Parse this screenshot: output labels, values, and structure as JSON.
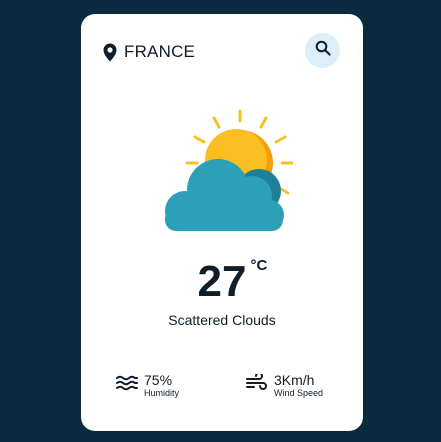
{
  "location": {
    "icon": "location-pin-icon",
    "name": "FRANCE"
  },
  "search": {
    "icon": "search-icon"
  },
  "weather": {
    "icon": "partly-cloudy-icon",
    "temperature": "27",
    "unit": "°C",
    "description": "Scattered Clouds"
  },
  "stats": {
    "humidity": {
      "icon": "humidity-waves-icon",
      "value": "75%",
      "label": "Humidity"
    },
    "wind": {
      "icon": "wind-icon",
      "value": "3Km/h",
      "label": "Wind Speed"
    }
  },
  "colors": {
    "background": "#0b2a3f",
    "card": "#ffffff",
    "text": "#0f1e2a",
    "search_bg": "#dceef9",
    "sun": "#fbbf24",
    "sun_shade": "#f59e0b",
    "cloud": "#2ba0b8",
    "cloud_shade": "#1f7f96"
  }
}
